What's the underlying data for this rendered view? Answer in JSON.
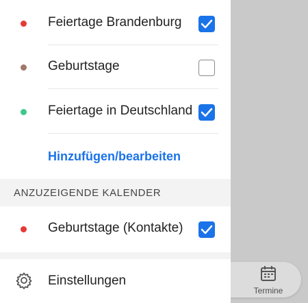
{
  "calendars": [
    {
      "label": "Feiertage Brandenburg",
      "color": "#e53935",
      "checked": true
    },
    {
      "label": "Geburtstage",
      "color": "#a1786a",
      "checked": false
    },
    {
      "label": "Feiertage in Deutschland",
      "color": "#3cc88a",
      "checked": true
    }
  ],
  "add_edit_link": "Hinzufügen/bearbeiten",
  "section_header": "ANZUZEIGENDE KALENDER",
  "displayed_calendars": [
    {
      "label": "Geburtstage (Kontakte)",
      "color": "#e53935",
      "checked": true
    }
  ],
  "settings_label": "Einstellungen",
  "bottom_nav": {
    "label": "Termine",
    "icon": "calendar-icon"
  },
  "accent_color": "#1a73e8"
}
